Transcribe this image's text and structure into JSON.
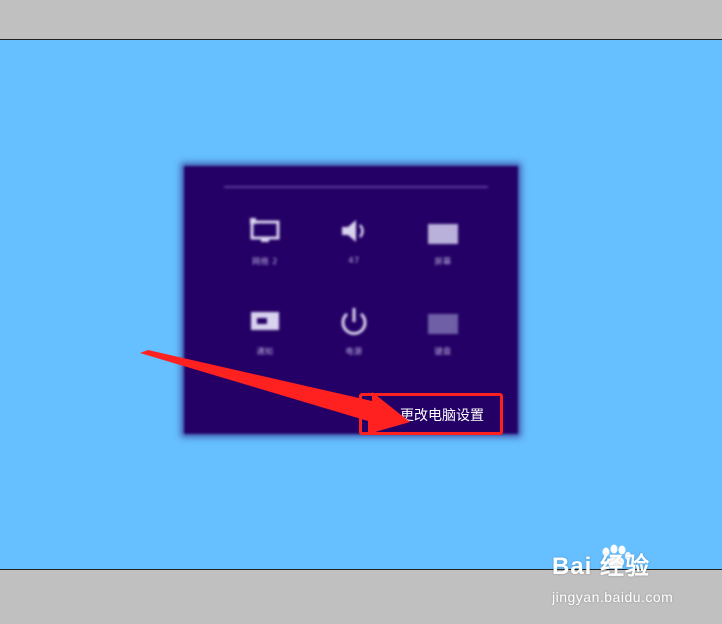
{
  "panel": {
    "tiles": [
      {
        "icon": "display-icon",
        "label": "网络 2"
      },
      {
        "icon": "speaker-icon",
        "label": "47"
      },
      {
        "icon": "brightness-icon",
        "label": "屏幕"
      },
      {
        "icon": "keyboard-icon",
        "label": "通知"
      },
      {
        "icon": "power-icon",
        "label": "电源"
      },
      {
        "icon": "language-icon",
        "label": "键盘"
      }
    ],
    "settings_link": "更改电脑设置"
  },
  "annotation": {
    "highlight_color": "#ff2020",
    "arrow_color": "#ff2020"
  },
  "watermark": {
    "brand": "Bai 经验",
    "site": "jingyan.baidu.com"
  },
  "colors": {
    "background": "#66bfff",
    "panel": "#240066",
    "frame": "#c0c0c0"
  }
}
